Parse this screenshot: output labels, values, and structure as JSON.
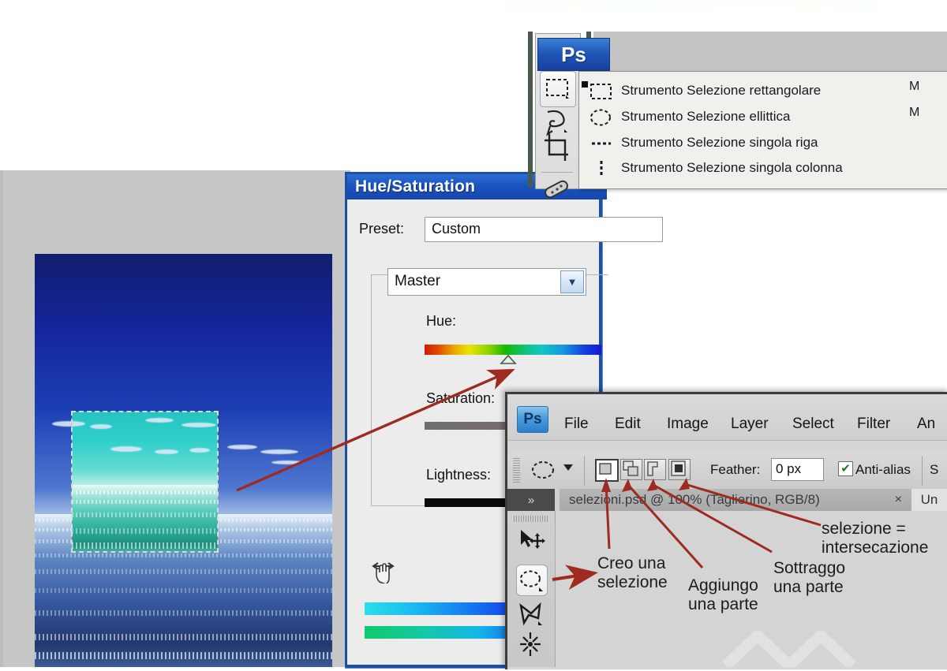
{
  "meta": {
    "app": "Adobe Photoshop",
    "language": "it",
    "ps_logo": "Ps"
  },
  "colors": {
    "dialog_titlebar": "#1b50a8",
    "arrow_red": "#a02822",
    "selection_cyan": "#2fcfca",
    "sky_blue": "#14259a",
    "desktop_gray": "#c6c6c6",
    "panel_gray": "#d6d6d6"
  },
  "hue_saturation_dialog": {
    "title": "Hue/Saturation",
    "preset_label": "Preset:",
    "preset_value": "Custom",
    "channel_value": "Master",
    "channel_arrow_icon": "chevron-down-icon",
    "sliders": [
      {
        "label": "Hue:",
        "name": "hue"
      },
      {
        "label": "Saturation:",
        "name": "saturation"
      },
      {
        "label": "Lightness:",
        "name": "lightness"
      }
    ],
    "hand_icon": "hand-scrub-icon"
  },
  "tool_flyout": {
    "logo": "Ps",
    "selected_index": 0,
    "items": [
      {
        "icon": "rectangular-marquee-icon",
        "label": "Strumento Selezione rettangolare",
        "shortcut": "M"
      },
      {
        "icon": "elliptical-marquee-icon",
        "label": "Strumento Selezione ellittica",
        "shortcut": "M"
      },
      {
        "icon": "single-row-marquee-icon",
        "label": "Strumento Selezione singola riga",
        "shortcut": ""
      },
      {
        "icon": "single-column-marquee-icon",
        "label": "Strumento Selezione singola colonna",
        "shortcut": ""
      }
    ],
    "toolbar_icons": [
      "rectangular-marquee-icon",
      "lasso-icon",
      "crop-icon",
      "healing-brush-icon"
    ]
  },
  "photoshop_window": {
    "logo": "Ps",
    "menus": [
      "File",
      "Edit",
      "Image",
      "Layer",
      "Select",
      "Filter",
      "An"
    ],
    "options_bar": {
      "active_tool_icon": "elliptical-marquee-icon",
      "tool_caret_icon": "caret-down-icon",
      "selection_mode_buttons": [
        {
          "icon": "new-selection-icon",
          "name": "new-selection",
          "active": true
        },
        {
          "icon": "add-to-selection-icon",
          "name": "add-to-selection",
          "active": false
        },
        {
          "icon": "subtract-from-selection-icon",
          "name": "subtract-from-selection",
          "active": false
        },
        {
          "icon": "intersect-selection-icon",
          "name": "intersect-selection",
          "active": false
        }
      ],
      "feather_label": "Feather:",
      "feather_value": "0 px",
      "antialias_label": "Anti-alias",
      "antialias_checked": true,
      "trailing_label": "S"
    },
    "tab_bar": {
      "collapse_icon": "chevron-double-right-icon",
      "document_tab": "selezioni.psd @ 100% (Taglierino, RGB/8)",
      "close_icon": "×",
      "next_tab": "Un"
    },
    "tools_panel_icons": [
      "move-icon",
      "elliptical-marquee-icon",
      "polygonal-lasso-icon",
      "magic-wand-icon"
    ]
  },
  "annotations": [
    {
      "id": "anno1",
      "lines": [
        "Creo una",
        "selezione"
      ]
    },
    {
      "id": "anno2",
      "lines": [
        "Aggiungo",
        "una parte"
      ]
    },
    {
      "id": "anno3",
      "lines": [
        "Sottraggo",
        "una parte"
      ]
    },
    {
      "id": "anno4",
      "lines": [
        "selezione =",
        "intersecazione"
      ]
    }
  ],
  "canvas_image": {
    "description": "sea-and-sky-photo",
    "selection": "rectangular-marquee-selection-hue-shifted"
  }
}
